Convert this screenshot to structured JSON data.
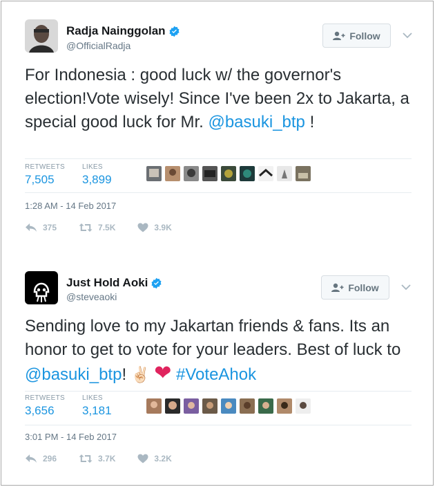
{
  "follow_label": "Follow",
  "colors": {
    "link": "#1b95e0",
    "verified": "#1da1f2",
    "heart": "#e0245e"
  },
  "tweets": [
    {
      "name": "Radja Nainggolan",
      "handle": "@OfficialRadja",
      "text_parts": [
        "For Indonesia : good luck w/ the governor's election!Vote wisely! Since I've been 2x to Jakarta, a special good luck for Mr. ",
        "@basuki_btp",
        " !"
      ],
      "retweets_label": "RETWEETS",
      "retweets": "7,505",
      "likes_label": "LIKES",
      "likes": "3,899",
      "timestamp": "1:28 AM - 14 Feb 2017",
      "replies_count": "375",
      "retweet_count_short": "7.5K",
      "like_count_short": "3.9K"
    },
    {
      "name": "Just Hold Aoki",
      "handle": "@steveaoki",
      "text_parts": [
        "Sending love to my Jakartan friends & fans. Its an honor to get to vote for your leaders. Best of luck to ",
        "@basuki_btp",
        "! ",
        "✌🏻",
        "❤",
        " ",
        "#VoteAhok"
      ],
      "retweets_label": "RETWEETS",
      "retweets": "3,656",
      "likes_label": "LIKES",
      "likes": "3,181",
      "timestamp": "3:01 PM - 14 Feb 2017",
      "replies_count": "296",
      "retweet_count_short": "3.7K",
      "like_count_short": "3.2K"
    }
  ]
}
